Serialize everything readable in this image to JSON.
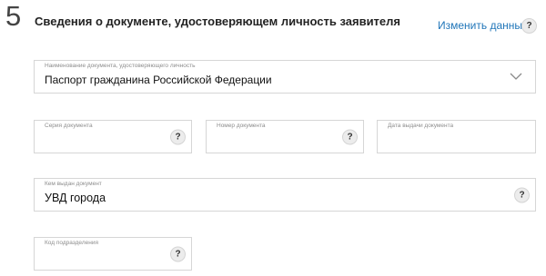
{
  "section": {
    "step_number": "5",
    "title": "Сведения о документе, удостоверяющем личность заявителя",
    "edit_link": "Изменить данные",
    "help_glyph": "?"
  },
  "fields": {
    "document_type": {
      "label": "Наименование документа, удостоверяющего личность",
      "value": "Паспорт гражданина Российской Федерации",
      "icon": "chevron-down-icon"
    },
    "series": {
      "label": "Серия документа",
      "value": ""
    },
    "number": {
      "label": "Номер документа",
      "value": ""
    },
    "issue_date": {
      "label": "Дата выдачи документа",
      "value": ""
    },
    "issuer": {
      "label": "Кем выдан документ",
      "value": "УВД города"
    },
    "division_code": {
      "label": "Код подразделения",
      "value": ""
    }
  },
  "colors": {
    "link": "#2176b9",
    "border": "#d6d6d6",
    "label": "#8d8d8d",
    "help_bg": "#ececec"
  }
}
